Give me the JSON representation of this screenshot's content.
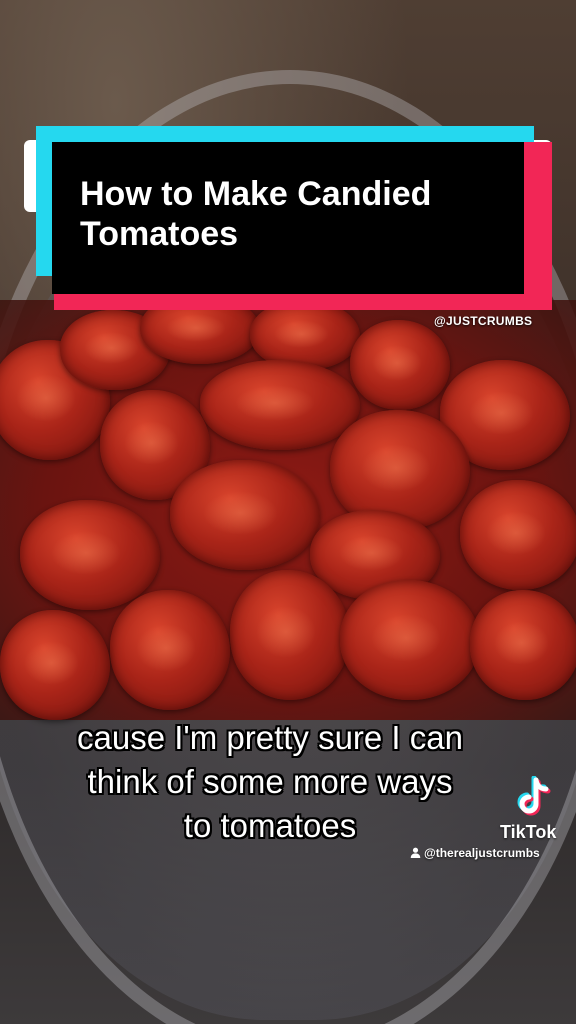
{
  "video": {
    "title_line1": "How to Make Candied",
    "title_line2": "Tomatoes",
    "handle": "@JUSTCRUMBS",
    "caption_line1": "cause I'm pretty sure I can",
    "caption_line2": "think of some more ways",
    "caption_line3": "to tomatoes"
  },
  "watermark": {
    "brand": "TikTok",
    "username": "@therealjustcrumbs",
    "icon": "tiktok-logo-icon",
    "user_icon": "person-icon"
  },
  "colors": {
    "title_bg": "#000000",
    "accent_cyan": "#25d8ef",
    "accent_red": "#f22656",
    "text": "#ffffff"
  }
}
